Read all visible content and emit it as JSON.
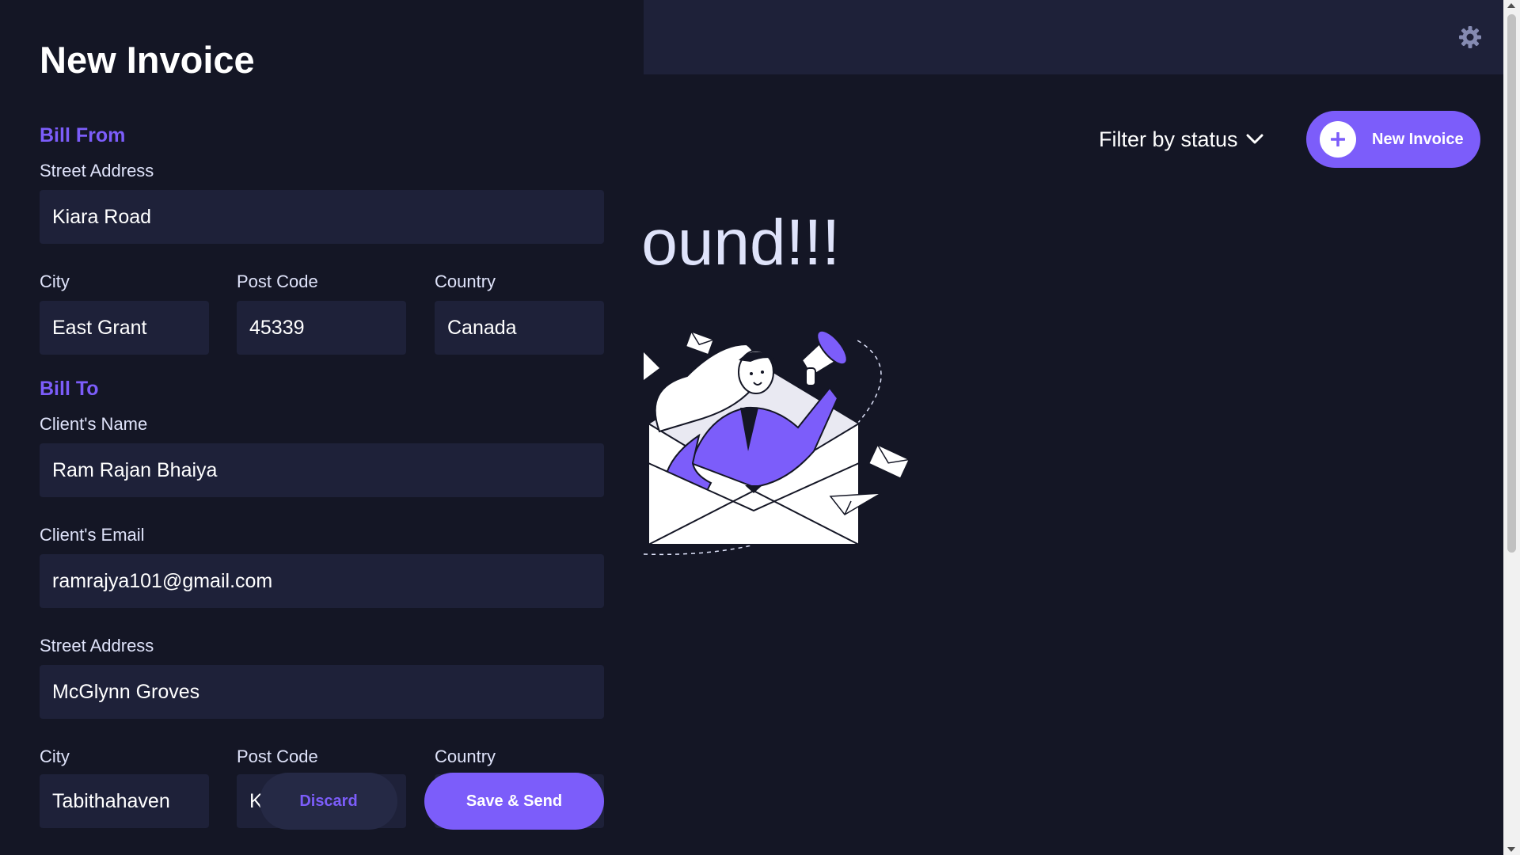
{
  "header": {
    "settings_icon": "gear-icon"
  },
  "toolbar": {
    "filter_label": "Filter by status",
    "new_invoice_label": "New Invoice"
  },
  "empty_state": {
    "message": "data found!!!",
    "illustration": "woman-with-megaphone-in-envelope"
  },
  "form": {
    "title": "New Invoice",
    "bill_from": {
      "heading": "Bill From",
      "street_label": "Street Address",
      "street_value": "Kiara Road",
      "city_label": "City",
      "city_value": "East Grant",
      "post_code_label": "Post Code",
      "post_code_value": "45339",
      "country_label": "Country",
      "country_value": "Canada"
    },
    "bill_to": {
      "heading": "Bill To",
      "name_label": "Client's Name",
      "name_value": "Ram Rajan Bhaiya",
      "email_label": "Client's Email",
      "email_value": "ramrajya101@gmail.com",
      "street_label": "Street Address",
      "street_value": "McGlynn Groves",
      "city_label": "City",
      "city_value": "Tabithahaven",
      "post_code_label": "Post Code",
      "post_code_value": "K",
      "country_label": "Country",
      "country_value": ""
    },
    "discard_label": "Discard",
    "save_label": "Save & Send"
  },
  "colors": {
    "accent": "#7c5dfa",
    "background": "#141625",
    "surface": "#1e2139"
  }
}
